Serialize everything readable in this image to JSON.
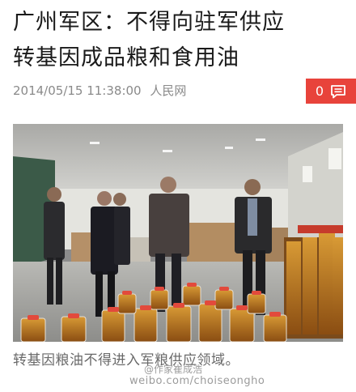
{
  "article": {
    "title_line1": "广州军区：不得向驻军供应",
    "title_line2": "转基因成品粮和食用油",
    "date": "2014/05/15 11:38:00",
    "source": "人民网"
  },
  "comments": {
    "count": "0",
    "icon": "comment-icon"
  },
  "photo": {
    "caption": "转基因粮油不得进入军粮供应领域。",
    "watermark_handle": "@作家崔成浩",
    "watermark_url": "weibo.com/choiseongho"
  },
  "colors": {
    "accent": "#e8433b",
    "meta_text": "#8a8a8a",
    "caption_text": "#6a6a6a"
  }
}
